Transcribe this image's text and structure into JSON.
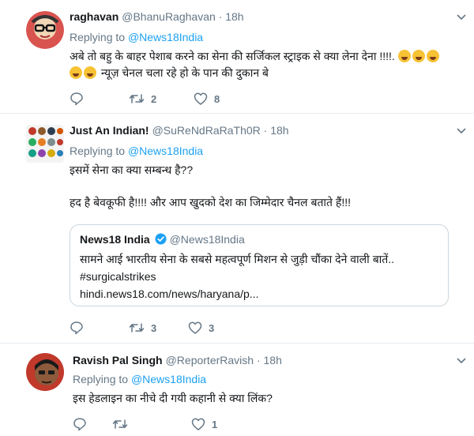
{
  "tweets": [
    {
      "name": "raghavan",
      "handle": "@BhanuRaghavan · 18h",
      "replying_prefix": "Replying to",
      "replying_to": "@News18India",
      "line1": "अबे तो बहु के बाहर पेशाब करने का सेना की सर्जिकल स्ट्राइक से क्या लेना देना !!!!.",
      "line2": "न्यूज़ चेनल चला रहे हो के पान की दुकान बे",
      "replies": "",
      "retweets": "2",
      "likes": "8"
    },
    {
      "name": "Just An Indian!",
      "handle": "@SuReNdRaRaTh0R · 18h",
      "replying_prefix": "Replying to",
      "replying_to": "@News18India",
      "line1": "इसमें सेना का क्या सम्बन्ध है??",
      "line2": "हद है बेवकूफी है!!!! और आप खुदको देश का जिम्मेदार चैनल बताते हैं!!!",
      "quote": {
        "name": "News18 India",
        "handle": "@News18India",
        "text": "सामने आई भारतीय सेना के सबसे महत्वपूर्ण मिशन से जुड़ी चौंका देने वाली बातें..",
        "hashtag": "#surgicalstrikes",
        "link": "hindi.news18.com/news/haryana/p..."
      },
      "replies": "",
      "retweets": "3",
      "likes": "3"
    },
    {
      "name": "Ravish Pal Singh",
      "handle": "@ReporterRavish · 18h",
      "replying_prefix": "Replying to",
      "replying_to": "@News18India",
      "line1": "इस हेडलाइन का नीचे दी गयी कहानी से क्या लिंक?",
      "replies": "",
      "retweets": "",
      "likes": "1"
    }
  ],
  "colors": {
    "link": "#1da1f2",
    "muted": "#657786",
    "verified": "#1da1f2",
    "divider": "#e6ecf0"
  },
  "icons": [
    "reply-icon",
    "retweet-icon",
    "like-icon",
    "chevron-down-icon",
    "verified-badge-icon",
    "emoji-icon"
  ]
}
